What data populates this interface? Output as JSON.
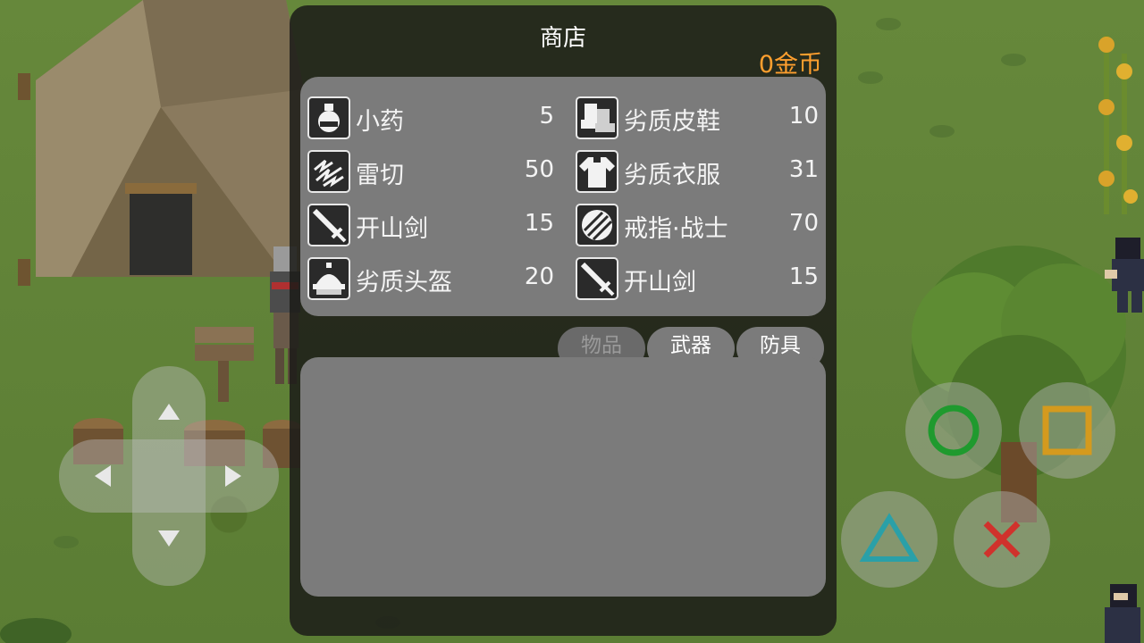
{
  "shop": {
    "title": "商店",
    "gold": "0金币"
  },
  "items": [
    {
      "name": "小药",
      "price": "5",
      "icon": "potion-icon"
    },
    {
      "name": "劣质皮鞋",
      "price": "10",
      "icon": "boots-icon"
    },
    {
      "name": "雷切",
      "price": "50",
      "icon": "lightning-icon"
    },
    {
      "name": "劣质衣服",
      "price": "31",
      "icon": "shirt-icon"
    },
    {
      "name": "开山剑",
      "price": "15",
      "icon": "sword-icon"
    },
    {
      "name": "戒指·战士",
      "price": "70",
      "icon": "ring-icon"
    },
    {
      "name": "劣质头盔",
      "price": "20",
      "icon": "helmet-icon"
    },
    {
      "name": "开山剑",
      "price": "15",
      "icon": "sword-icon"
    }
  ],
  "tabs": [
    {
      "label": "物品",
      "state": "disabled"
    },
    {
      "label": "武器",
      "state": "normal"
    },
    {
      "label": "防具",
      "state": "normal"
    }
  ],
  "controls": {
    "dpad": [
      "up",
      "down",
      "left",
      "right"
    ],
    "buttons": [
      {
        "name": "circle",
        "color": "#1f9a2e"
      },
      {
        "name": "square",
        "color": "#d49a1e"
      },
      {
        "name": "triangle",
        "color": "#2aa0a8"
      },
      {
        "name": "cross",
        "color": "#d0322c"
      }
    ]
  }
}
